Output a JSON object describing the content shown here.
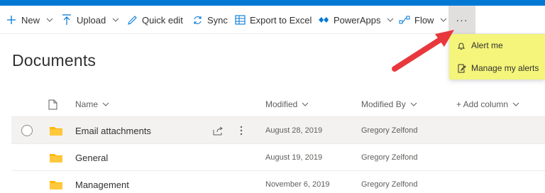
{
  "command_bar": {
    "new_label": "New",
    "upload_label": "Upload",
    "quick_edit_label": "Quick edit",
    "sync_label": "Sync",
    "export_label": "Export to Excel",
    "powerapps_label": "PowerApps",
    "flow_label": "Flow",
    "more_label": "···"
  },
  "more_menu": {
    "items": [
      {
        "label": "Alert me",
        "icon": "bell-icon"
      },
      {
        "label": "Manage my alerts",
        "icon": "edit-note-icon"
      }
    ],
    "highlight_color": "#f4f57a"
  },
  "page": {
    "title": "Documents"
  },
  "list": {
    "columns": {
      "name": "Name",
      "modified": "Modified",
      "modified_by": "Modified By",
      "add_column": "+ Add column"
    },
    "rows": [
      {
        "name": "Email attachments",
        "modified": "August 28, 2019",
        "modified_by": "Gregory Zelfond",
        "selected": true
      },
      {
        "name": "General",
        "modified": "August 19, 2019",
        "modified_by": "Gregory Zelfond",
        "selected": false
      },
      {
        "name": "Management",
        "modified": "November 6, 2019",
        "modified_by": "Gregory Zelfond",
        "selected": false
      }
    ]
  },
  "colors": {
    "brand": "#0078d4",
    "arrow": "#e8383d",
    "folder": "#ffb900"
  }
}
